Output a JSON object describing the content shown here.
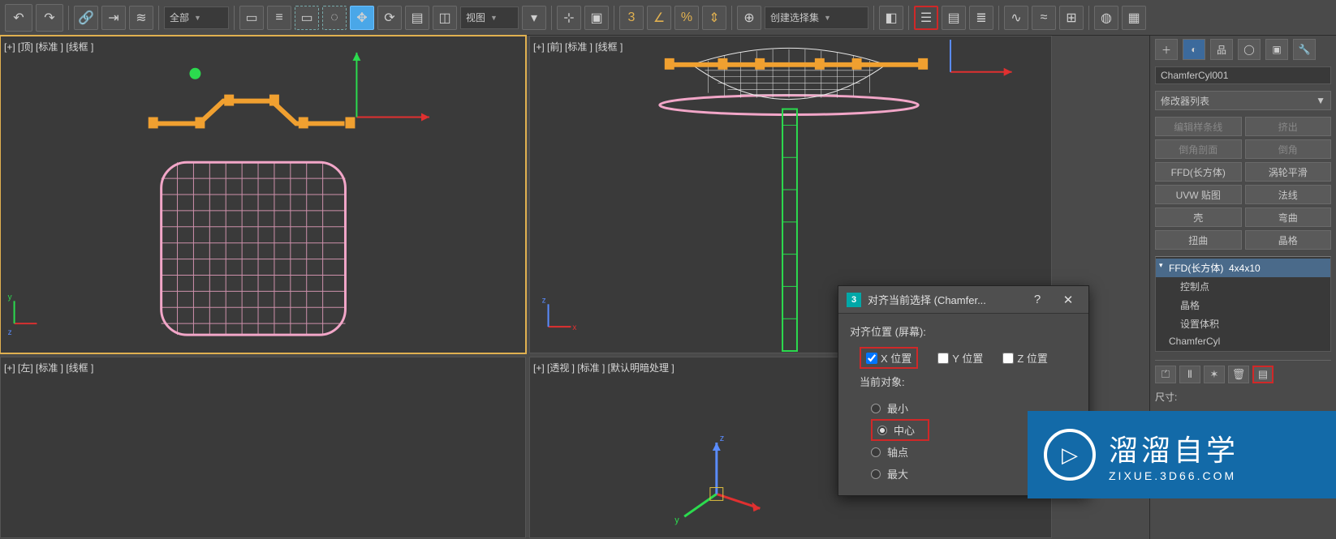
{
  "toolbar": {
    "filter": "全部",
    "view_drop": "视图",
    "selset": "创建选择集"
  },
  "viewports": {
    "top": "[+] [顶] [标准 ] [线框 ]",
    "front": "[+] [前] [标准 ] [线框 ]",
    "left": "[+] [左] [标准 ] [线框 ]",
    "persp": "[+] [透视 ] [标准 ] [默认明暗处理 ]"
  },
  "panel": {
    "object_name": "ChamferCyl001",
    "mod_list_label": "修改器列表",
    "buttons": {
      "edit_spline": "编辑样条线",
      "extrude": "挤出",
      "bevel_profile": "倒角剖面",
      "chamfer": "倒角",
      "ffd_box": "FFD(长方体)",
      "turbo": "涡轮平滑",
      "uvw": "UVW 贴图",
      "normal": "法线",
      "shell": "壳",
      "bend": "弯曲",
      "twist": "扭曲",
      "lattice": "晶格"
    },
    "stack": {
      "ffd": "FFD(长方体)",
      "ffd_dim": "4x4x10",
      "sub_cp": "控制点",
      "sub_lat": "晶格",
      "sub_vol": "设置体积",
      "base": "ChamferCyl"
    },
    "dim_label": "尺寸:"
  },
  "dialog": {
    "title": "对齐当前选择 (Chamfer...",
    "help": "?",
    "section": "对齐位置 (屏幕):",
    "x": "X 位置",
    "y": "Y 位置",
    "z": "Z 位置",
    "current_obj": "当前对象:",
    "min": "最小",
    "center": "中心",
    "pivot": "轴点",
    "max": "最大"
  },
  "watermark": {
    "title": "溜溜自学",
    "sub": "ZIXUE.3D66.COM"
  },
  "icons": {
    "undo": "↶",
    "redo": "↷",
    "link": "🔗",
    "unlink": "⇥",
    "bind": "≋",
    "sel": "▭",
    "name": "≡",
    "rect": "▭",
    "lasso": "◌",
    "move": "✥",
    "rot": "⟳",
    "scale": "▤",
    "mirror": "◫",
    "view": "▾",
    "snap": "▦",
    "angle": "∠",
    "pct": "%",
    "num3": "3",
    "axis": "⊕",
    "curve": "∿",
    "brac": "{ }",
    "key": "🔑",
    "gear": "⚙",
    "list": "☰",
    "layers": "≣",
    "plus": "＋",
    "modify": "◐",
    "hier": "⬚",
    "motion": "◯",
    "disp": "▣",
    "util": "🔧"
  }
}
